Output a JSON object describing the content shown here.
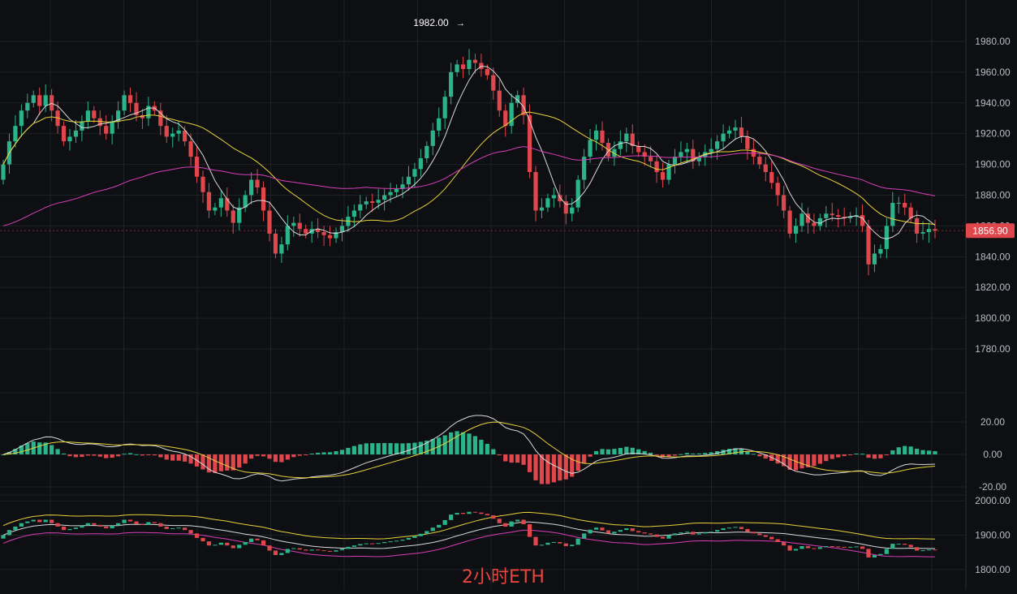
{
  "caption": "2小时ETH",
  "price_tag": "1856.90",
  "peak_label": "1982.00",
  "colors": {
    "background": "#0e0f12",
    "grid": "#1f2126",
    "up": "#2bb38a",
    "down": "#e0474c",
    "ma_short": "#d9d9d9",
    "ma_mid": "#e6d23a",
    "ma_long": "#d63fb8",
    "tag": "#e0474c",
    "axis_text": "#b8bcc4"
  },
  "chart_data": [
    {
      "type": "candlestick",
      "panel": "price",
      "ylim": [
        1770,
        1990
      ],
      "y_ticks": [
        "1980.00",
        "1960.00",
        "1940.00",
        "1920.00",
        "1900.00",
        "1880.00",
        "1860.00",
        "1840.00",
        "1820.00",
        "1800.00",
        "1780.00"
      ],
      "last_price": 1856.9,
      "peak": 1982.0,
      "grid": true,
      "close": [
        1900,
        1915,
        1925,
        1935,
        1940,
        1945,
        1938,
        1945,
        1935,
        1925,
        1915,
        1918,
        1922,
        1928,
        1935,
        1930,
        1925,
        1920,
        1928,
        1935,
        1945,
        1940,
        1932,
        1930,
        1938,
        1935,
        1925,
        1918,
        1920,
        1922,
        1915,
        1905,
        1892,
        1882,
        1870,
        1872,
        1878,
        1870,
        1862,
        1872,
        1880,
        1890,
        1885,
        1870,
        1855,
        1842,
        1848,
        1860,
        1862,
        1858,
        1855,
        1858,
        1856,
        1854,
        1852,
        1856,
        1860,
        1866,
        1870,
        1874,
        1876,
        1875,
        1877,
        1880,
        1882,
        1884,
        1887,
        1892,
        1897,
        1904,
        1912,
        1922,
        1930,
        1944,
        1960,
        1965,
        1962,
        1968,
        1966,
        1962,
        1958,
        1948,
        1935,
        1925,
        1940,
        1945,
        1932,
        1895,
        1870,
        1872,
        1878,
        1880,
        1876,
        1868,
        1872,
        1890,
        1905,
        1916,
        1922,
        1914,
        1905,
        1910,
        1915,
        1920,
        1912,
        1908,
        1905,
        1902,
        1895,
        1890,
        1900,
        1905,
        1908,
        1910,
        1902,
        1905,
        1908,
        1910,
        1915,
        1920,
        1922,
        1924,
        1918,
        1910,
        1905,
        1900,
        1895,
        1888,
        1880,
        1870,
        1855,
        1860,
        1868,
        1862,
        1860,
        1865,
        1868,
        1867,
        1866,
        1865,
        1866,
        1867,
        1860,
        1835,
        1842,
        1845,
        1860,
        1875,
        1875,
        1872,
        1865,
        1855,
        1856,
        1858,
        1856.9
      ],
      "open": [
        1890,
        1900,
        1915,
        1925,
        1935,
        1940,
        1945,
        1938,
        1945,
        1935,
        1925,
        1915,
        1918,
        1922,
        1928,
        1935,
        1930,
        1925,
        1920,
        1928,
        1935,
        1945,
        1940,
        1932,
        1930,
        1938,
        1935,
        1925,
        1918,
        1920,
        1922,
        1915,
        1905,
        1892,
        1882,
        1870,
        1872,
        1878,
        1870,
        1862,
        1872,
        1880,
        1890,
        1885,
        1870,
        1855,
        1842,
        1848,
        1860,
        1862,
        1858,
        1855,
        1858,
        1856,
        1854,
        1852,
        1856,
        1860,
        1866,
        1870,
        1874,
        1876,
        1875,
        1877,
        1880,
        1882,
        1884,
        1887,
        1892,
        1897,
        1904,
        1912,
        1922,
        1930,
        1944,
        1960,
        1965,
        1962,
        1968,
        1966,
        1962,
        1958,
        1948,
        1935,
        1925,
        1940,
        1945,
        1932,
        1895,
        1870,
        1872,
        1878,
        1880,
        1876,
        1868,
        1872,
        1890,
        1905,
        1916,
        1922,
        1914,
        1905,
        1910,
        1915,
        1920,
        1912,
        1908,
        1905,
        1902,
        1895,
        1890,
        1900,
        1905,
        1908,
        1910,
        1902,
        1905,
        1908,
        1910,
        1915,
        1920,
        1922,
        1924,
        1918,
        1910,
        1905,
        1900,
        1895,
        1888,
        1880,
        1870,
        1855,
        1860,
        1868,
        1862,
        1860,
        1865,
        1868,
        1867,
        1866,
        1865,
        1866,
        1867,
        1860,
        1835,
        1842,
        1845,
        1860,
        1875,
        1875,
        1872,
        1865,
        1855,
        1856,
        1858
      ]
    },
    {
      "type": "bar",
      "panel": "macd",
      "ylim": [
        -25,
        25
      ],
      "y_ticks": [
        "20.00",
        "0.00",
        "-20.00"
      ],
      "grid": true
    },
    {
      "type": "line",
      "panel": "overview",
      "ylim": [
        1790,
        2010
      ],
      "y_ticks": [
        "2000.00",
        "1900.00",
        "1800.00"
      ],
      "grid": true
    }
  ]
}
